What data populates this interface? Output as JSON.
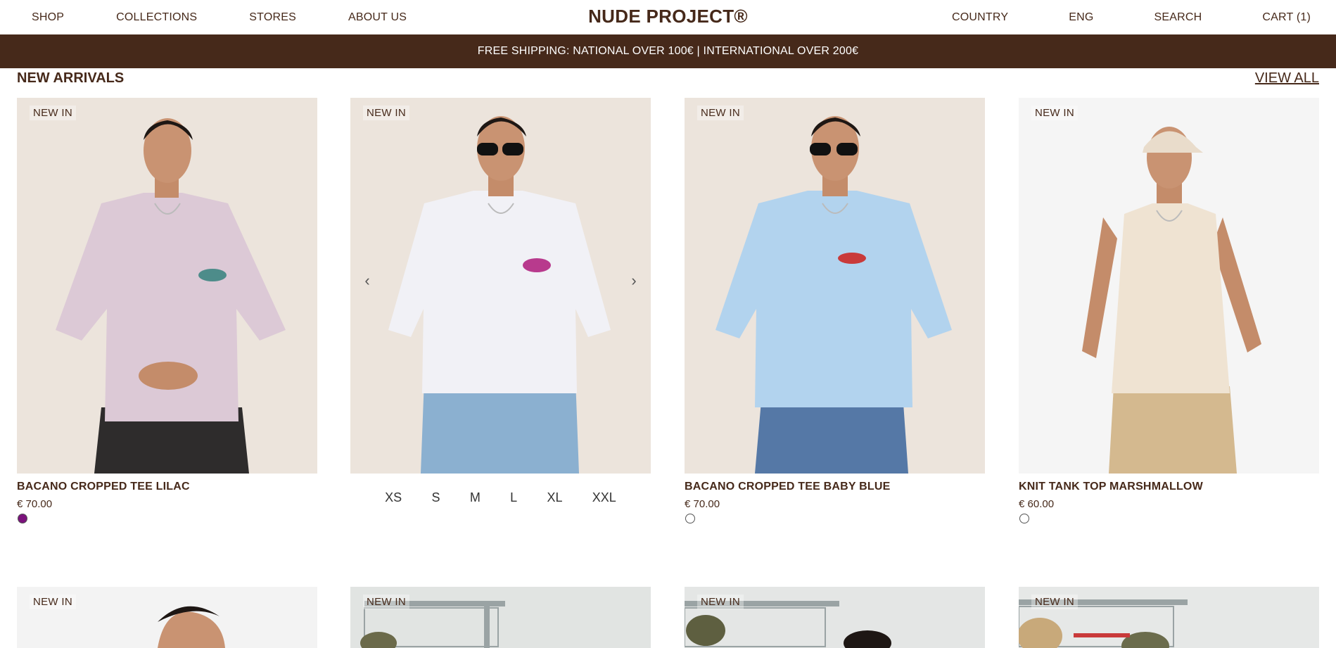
{
  "header": {
    "nav_left": [
      "SHOP",
      "COLLECTIONS",
      "STORES",
      "ABOUT US"
    ],
    "logo": "NUDE PROJECT®",
    "nav_right": [
      "COUNTRY",
      "ENG",
      "SEARCH",
      "CART (1)"
    ]
  },
  "banner": {
    "text": "FREE SHIPPING: NATIONAL OVER 100€ | INTERNATIONAL OVER 200€"
  },
  "section": {
    "title": "NEW ARRIVALS",
    "view_all": "VIEW ALL"
  },
  "products": [
    {
      "badge": "NEW IN",
      "name": "BACANO CROPPED TEE LILAC",
      "price": "€ 70.00",
      "swatch_color": "#7b127c",
      "shirt_color": "#dcc9d6"
    },
    {
      "badge": "NEW IN",
      "sizes": [
        "XS",
        "S",
        "M",
        "L",
        "XL",
        "XXL"
      ],
      "shirt_color": "#f1f1f6",
      "prev_icon": "chevron-left-icon",
      "next_icon": "chevron-right-icon"
    },
    {
      "badge": "NEW IN",
      "name": "BACANO CROPPED TEE BABY BLUE",
      "price": "€ 70.00",
      "swatch_color": "#ffffff",
      "shirt_color": "#b2d3ee"
    },
    {
      "badge": "NEW IN",
      "name": "KNIT TANK TOP MARSHMALLOW",
      "price": "€ 60.00",
      "swatch_color": "#ffffff",
      "shirt_color": "#efe3d2"
    }
  ],
  "row2": [
    {
      "badge": "NEW IN"
    },
    {
      "badge": "NEW IN"
    },
    {
      "badge": "NEW IN"
    },
    {
      "badge": "NEW IN"
    }
  ]
}
